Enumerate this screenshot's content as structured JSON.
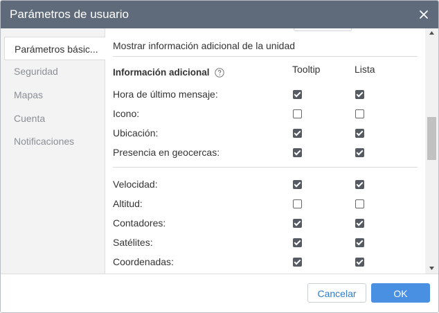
{
  "dialog": {
    "title": "Parámetros de usuario"
  },
  "sidebar": {
    "items": [
      {
        "label": "Parámetros básic...",
        "active": true
      },
      {
        "label": "Seguridad",
        "active": false
      },
      {
        "label": "Mapas",
        "active": false
      },
      {
        "label": "Cuenta",
        "active": false
      },
      {
        "label": "Notificaciones",
        "active": false
      }
    ]
  },
  "content": {
    "section_title": "Mostrar información adicional de la unidad",
    "info_label": "Información adicional",
    "columns": {
      "tooltip": "Tooltip",
      "list": "Lista"
    },
    "rows": [
      {
        "label": "Hora de último mensaje:",
        "tooltip": true,
        "list": true
      },
      {
        "label": "Icono:",
        "tooltip": false,
        "list": false
      },
      {
        "label": "Ubicación:",
        "tooltip": true,
        "list": true
      },
      {
        "label": "Presencia en geocercas:",
        "tooltip": true,
        "list": true
      },
      {
        "label": "Velocidad:",
        "tooltip": true,
        "list": true
      },
      {
        "label": "Altitud:",
        "tooltip": false,
        "list": false
      },
      {
        "label": "Contadores:",
        "tooltip": true,
        "list": true
      },
      {
        "label": "Satélites:",
        "tooltip": true,
        "list": true
      },
      {
        "label": "Coordenadas:",
        "tooltip": true,
        "list": true
      }
    ]
  },
  "footer": {
    "cancel_label": "Cancelar",
    "ok_label": "OK"
  },
  "colors": {
    "titlebar": "#5f6b7b",
    "accent": "#4a90e2",
    "checkbox_checked": "#555a63"
  },
  "icons": {
    "close": "close-icon",
    "help": "help-circle-icon"
  }
}
